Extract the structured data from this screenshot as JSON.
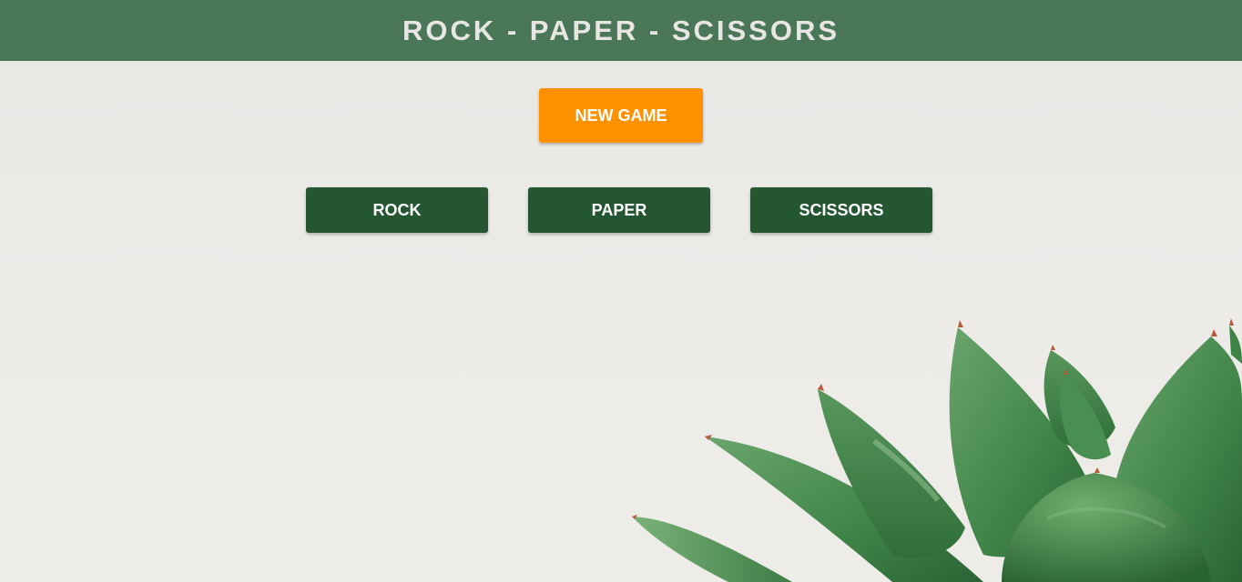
{
  "header": {
    "title": "ROCK - PAPER - SCISSORS"
  },
  "controls": {
    "new_game_label": "NEW GAME",
    "choices": [
      {
        "label": "ROCK"
      },
      {
        "label": "PAPER"
      },
      {
        "label": "SCISSORS"
      }
    ]
  },
  "colors": {
    "header_bg": "#4b7759",
    "new_game_bg": "#fd9100",
    "choice_bg": "#245632",
    "page_bg": "#eae8e5"
  },
  "background_image": {
    "icon": "succulent-plant-photo"
  }
}
